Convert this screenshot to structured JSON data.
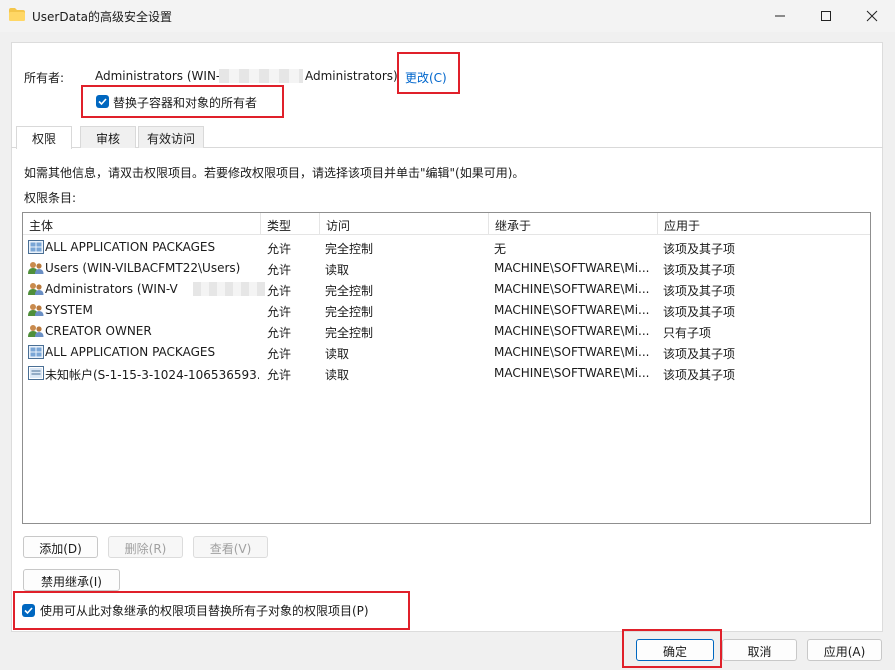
{
  "window": {
    "title": "UserData的高级安全设置"
  },
  "owner": {
    "label": "所有者:",
    "value": "Administrators (WIN-",
    "value_suffix": "Administrators)",
    "change_link": "更改(C)"
  },
  "replace_owner_checkbox": {
    "label": "替换子容器和对象的所有者",
    "checked": true
  },
  "tabs": [
    {
      "label": "权限",
      "active": true
    },
    {
      "label": "审核",
      "active": false
    },
    {
      "label": "有效访问",
      "active": false
    }
  ],
  "info_text": "如需其他信息，请双击权限项目。若要修改权限项目，请选择该项目并单击\"编辑\"(如果可用)。",
  "entries_label": "权限条目:",
  "table": {
    "columns": [
      "主体",
      "类型",
      "访问",
      "继承于",
      "应用于"
    ],
    "rows": [
      {
        "icon": "app-packages-icon",
        "principal": "ALL APPLICATION PACKAGES",
        "type": "允许",
        "access": "完全控制",
        "inherited": "无",
        "applies": "该项及其子项"
      },
      {
        "icon": "users-icon",
        "principal": "Users (WIN-VILBACFMT22\\Users)",
        "type": "允许",
        "access": "读取",
        "inherited": "MACHINE\\SOFTWARE\\Mi...",
        "applies": "该项及其子项"
      },
      {
        "icon": "users-icon",
        "principal": "Administrators (WIN-V",
        "type": "允许",
        "access": "完全控制",
        "inherited": "MACHINE\\SOFTWARE\\Mi...",
        "applies": "该项及其子项"
      },
      {
        "icon": "users-icon",
        "principal": "SYSTEM",
        "type": "允许",
        "access": "完全控制",
        "inherited": "MACHINE\\SOFTWARE\\Mi...",
        "applies": "该项及其子项"
      },
      {
        "icon": "users-icon",
        "principal": "CREATOR OWNER",
        "type": "允许",
        "access": "完全控制",
        "inherited": "MACHINE\\SOFTWARE\\Mi...",
        "applies": "只有子项"
      },
      {
        "icon": "app-packages-icon",
        "principal": "ALL APPLICATION PACKAGES",
        "type": "允许",
        "access": "读取",
        "inherited": "MACHINE\\SOFTWARE\\Mi...",
        "applies": "该项及其子项"
      },
      {
        "icon": "unknown-account-icon",
        "principal": "未知帐户(S-1-15-3-1024-106536593...",
        "type": "允许",
        "access": "读取",
        "inherited": "MACHINE\\SOFTWARE\\Mi...",
        "applies": "该项及其子项"
      }
    ]
  },
  "buttons": {
    "add": "添加(D)",
    "remove": "删除(R)",
    "view": "查看(V)",
    "disable_inheritance": "禁用继承(I)",
    "ok": "确定",
    "cancel": "取消",
    "apply": "应用(A)"
  },
  "replace_child_checkbox": {
    "label": "使用可从此对象继承的权限项目替换所有子对象的权限项目(P)",
    "checked": true
  },
  "colors": {
    "accent": "#0067c0",
    "link": "#0066cc",
    "highlight_box": "#e0202a"
  }
}
